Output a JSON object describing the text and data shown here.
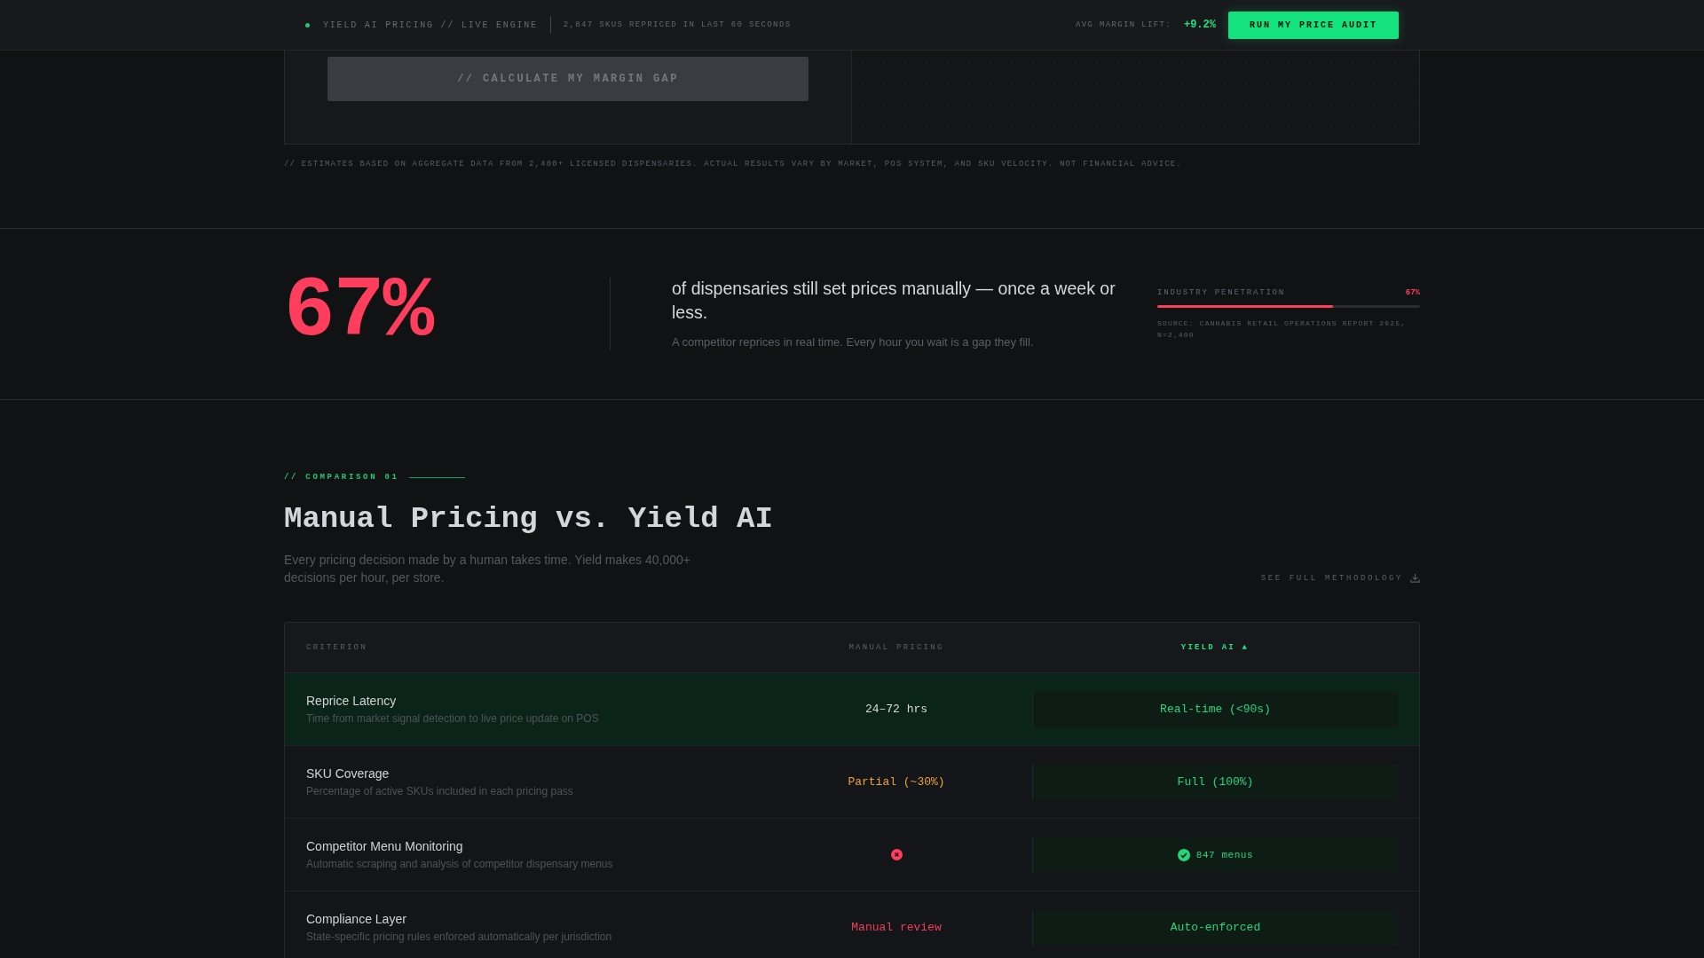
{
  "top_bar": {
    "live": true,
    "brand": "YIELD AI PRICING // LIVE ENGINE",
    "ticker": "2,847 SKUS REPRICED IN LAST 60 SECONDS",
    "metric_label": "AVG MARGIN LIFT:",
    "metric_value": "+9.2%",
    "cta": "RUN MY PRICE AUDIT"
  },
  "calculator": {
    "button": "// CALCULATE MY MARGIN GAP",
    "disabled": true,
    "disclaimer": "// ESTIMATES BASED ON AGGREGATE DATA FROM 2,400+ LICENSED DISPENSARIES. ACTUAL RESULTS VARY BY MARKET, POS SYSTEM, AND SKU VELOCITY. NOT FINANCIAL ADVICE."
  },
  "stat": {
    "value": "67%",
    "headline": "of dispensaries still set prices manually — once a week or less.",
    "subtext": "A competitor reprices in real time. Every hour you wait is a gap they fill.",
    "meter": {
      "label": "INDUSTRY PENETRATION",
      "reading": "67%",
      "level": 0.67,
      "source": "SOURCE: CANNABIS RETAIL OPERATIONS REPORT 2025, N=2,400"
    }
  },
  "comparison": {
    "eyebrow": "// COMPARISON 01",
    "title": "Manual Pricing vs. Yield AI",
    "description": "Every pricing decision made by a human takes time. Yield makes 40,000+ decisions per hour, per store.",
    "link": "SEE FULL METHODOLOGY",
    "table": {
      "columns": [
        {
          "label": "CRITERION",
          "accent": false
        },
        {
          "label": "MANUAL PRICING",
          "accent": false
        },
        {
          "label": "YIELD AI ▲",
          "accent": true
        }
      ],
      "rows": [
        {
          "title": "Reprice Latency",
          "description": "Time from market signal detection to live price update on POS",
          "highlighted": true,
          "manual": {
            "kind": "text",
            "text": "24–72 hrs",
            "color": "#d5d7da"
          },
          "yield": {
            "kind": "text",
            "text": "Real-time (<90s)"
          }
        },
        {
          "title": "SKU Coverage",
          "description": "Percentage of active SKUs included in each pricing pass",
          "highlighted": false,
          "manual": {
            "kind": "text",
            "text": "Partial (~30%)",
            "color": "#e8a33a"
          },
          "yield": {
            "kind": "text",
            "text": "Full (100%)"
          }
        },
        {
          "title": "Competitor Menu Monitoring",
          "description": "Automatic scraping and analysis of competitor dispensary menus",
          "highlighted": false,
          "manual": {
            "kind": "cross"
          },
          "yield": {
            "kind": "check",
            "text": "847 menus"
          }
        },
        {
          "title": "Compliance Layer",
          "description": "State-specific pricing rules enforced automatically per jurisdiction",
          "highlighted": false,
          "manual": {
            "kind": "text",
            "text": "Manual review",
            "color": "#ec3f5c"
          },
          "yield": {
            "kind": "text",
            "text": "Auto-enforced"
          }
        }
      ]
    }
  }
}
